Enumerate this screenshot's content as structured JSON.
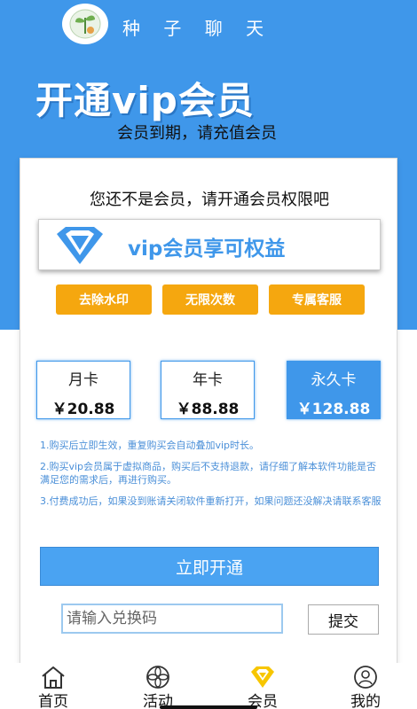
{
  "app": {
    "title": "种 子 聊 天",
    "logo_icon": "seedling-logo-icon"
  },
  "hero": {
    "title": "开通vip会员",
    "subtitle": "会员到期，请充值会员"
  },
  "card": {
    "notice": "您还不是会员，请开通会员权限吧",
    "vip_banner": {
      "icon": "diamond-icon",
      "text": "vip会员享可权益"
    },
    "perks": [
      "去除水印",
      "无限次数",
      "专属客服"
    ],
    "plans": [
      {
        "name": "月卡",
        "price": "￥20.88",
        "selected": false
      },
      {
        "name": "年卡",
        "price": "￥88.88",
        "selected": false
      },
      {
        "name": "永久卡",
        "price": "￥128.88",
        "selected": true
      }
    ],
    "terms": [
      "1.购买后立即生效，重复购买会自动叠加vip时长。",
      "2.购买vip会员属于虚拟商品，购买后不支持退款，请仔细了解本软件功能是否满足您的需求后，再进行购买。",
      "3.付费成功后，如果没到账请关闭软件重新打开，如果问题还没解决请联系客服"
    ],
    "open_button": "立即开通",
    "redeem": {
      "placeholder": "请输入兑换码",
      "submit_label": "提交"
    }
  },
  "nav": {
    "items": [
      {
        "label": "首页",
        "icon": "home-icon",
        "active": false
      },
      {
        "label": "活动",
        "icon": "flower-icon",
        "active": false
      },
      {
        "label": "会员",
        "icon": "vip-diamond-icon",
        "active": true
      },
      {
        "label": "我的",
        "icon": "profile-icon",
        "active": false
      }
    ]
  },
  "colors": {
    "primary": "#3f97ea",
    "accent": "#f5a70f",
    "nav_active": "#f7c600"
  }
}
